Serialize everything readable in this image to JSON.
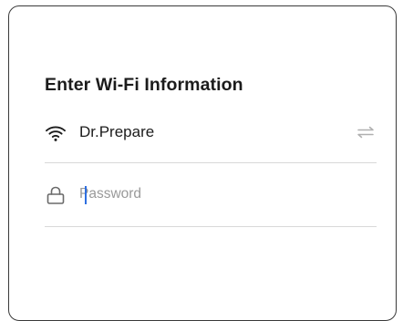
{
  "form": {
    "title": "Enter Wi-Fi Information",
    "network": {
      "icon": "wifi-icon",
      "ssid": "Dr.Prepare",
      "switch_icon": "switch-network-icon"
    },
    "password": {
      "icon": "lock-icon",
      "placeholder": "Password",
      "value": ""
    }
  },
  "colors": {
    "border": "#3a3a3a",
    "text": "#1c1c1c",
    "placeholder": "#9a9a9a",
    "divider": "#d8d8d8",
    "caret": "#2f6fe0",
    "switch_icon": "#b0b0b0"
  }
}
